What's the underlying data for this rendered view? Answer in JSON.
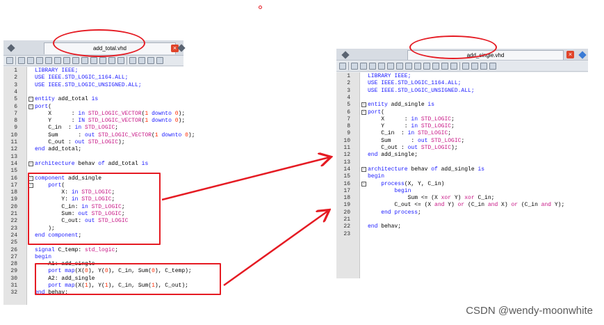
{
  "left_pane": {
    "tab_title": "add_total.vhd",
    "close_symbol": "×",
    "lines": [
      {
        "n": "1",
        "fold": "",
        "segs": [
          {
            "t": "LIBRARY IEEE;",
            "c": "kw"
          }
        ]
      },
      {
        "n": "2",
        "fold": "",
        "segs": [
          {
            "t": "USE IEEE.STD_LOGIC_1164.ALL;",
            "c": "kw"
          }
        ]
      },
      {
        "n": "3",
        "fold": "",
        "segs": [
          {
            "t": "USE IEEE.STD_LOGIC_UNSIGNED.ALL;",
            "c": "kw"
          }
        ]
      },
      {
        "n": "4",
        "fold": "",
        "segs": []
      },
      {
        "n": "5",
        "fold": "-",
        "segs": [
          {
            "t": "entity",
            "c": "kw"
          },
          {
            "t": " add_total ",
            "c": ""
          },
          {
            "t": "is",
            "c": "kw"
          }
        ]
      },
      {
        "n": "6",
        "fold": "-",
        "segs": [
          {
            "t": "port",
            "c": "kw"
          },
          {
            "t": "(",
            "c": ""
          }
        ]
      },
      {
        "n": "7",
        "fold": "",
        "segs": [
          {
            "t": "    X      : ",
            "c": ""
          },
          {
            "t": "in",
            "c": "kw"
          },
          {
            "t": " ",
            "c": ""
          },
          {
            "t": "STD_LOGIC_VECTOR",
            "c": "ty"
          },
          {
            "t": "(",
            "c": ""
          },
          {
            "t": "1",
            "c": "nm"
          },
          {
            "t": " ",
            "c": ""
          },
          {
            "t": "downto",
            "c": "kw"
          },
          {
            "t": " ",
            "c": ""
          },
          {
            "t": "0",
            "c": "nm"
          },
          {
            "t": ");",
            "c": ""
          }
        ]
      },
      {
        "n": "8",
        "fold": "",
        "segs": [
          {
            "t": "    Y      : ",
            "c": ""
          },
          {
            "t": "IN",
            "c": "kw"
          },
          {
            "t": " ",
            "c": ""
          },
          {
            "t": "STD_LOGIC_VECTOR",
            "c": "ty"
          },
          {
            "t": "(",
            "c": ""
          },
          {
            "t": "1",
            "c": "nm"
          },
          {
            "t": " ",
            "c": ""
          },
          {
            "t": "downto",
            "c": "kw"
          },
          {
            "t": " ",
            "c": ""
          },
          {
            "t": "0",
            "c": "nm"
          },
          {
            "t": ");",
            "c": ""
          }
        ]
      },
      {
        "n": "9",
        "fold": "",
        "segs": [
          {
            "t": "    C_in  : ",
            "c": ""
          },
          {
            "t": "in",
            "c": "kw"
          },
          {
            "t": " ",
            "c": ""
          },
          {
            "t": "STD_LOGIC",
            "c": "ty"
          },
          {
            "t": ";",
            "c": ""
          }
        ]
      },
      {
        "n": "10",
        "fold": "",
        "segs": [
          {
            "t": "    Sum      : ",
            "c": ""
          },
          {
            "t": "out",
            "c": "kw"
          },
          {
            "t": " ",
            "c": ""
          },
          {
            "t": "STD_LOGIC_VECTOR",
            "c": "ty"
          },
          {
            "t": "(",
            "c": ""
          },
          {
            "t": "1",
            "c": "nm"
          },
          {
            "t": " ",
            "c": ""
          },
          {
            "t": "downto",
            "c": "kw"
          },
          {
            "t": " ",
            "c": ""
          },
          {
            "t": "0",
            "c": "nm"
          },
          {
            "t": ");",
            "c": ""
          }
        ]
      },
      {
        "n": "11",
        "fold": "",
        "segs": [
          {
            "t": "    C_out : ",
            "c": ""
          },
          {
            "t": "out",
            "c": "kw"
          },
          {
            "t": " ",
            "c": ""
          },
          {
            "t": "STD_LOGIC",
            "c": "ty"
          },
          {
            "t": ");",
            "c": ""
          }
        ]
      },
      {
        "n": "12",
        "fold": "",
        "segs": [
          {
            "t": "end",
            "c": "kw"
          },
          {
            "t": " add_total;",
            "c": ""
          }
        ]
      },
      {
        "n": "13",
        "fold": "",
        "segs": []
      },
      {
        "n": "14",
        "fold": "-",
        "segs": [
          {
            "t": "architecture",
            "c": "kw"
          },
          {
            "t": " behav ",
            "c": ""
          },
          {
            "t": "of",
            "c": "kw"
          },
          {
            "t": " add_total ",
            "c": ""
          },
          {
            "t": "is",
            "c": "kw"
          }
        ]
      },
      {
        "n": "15",
        "fold": "",
        "segs": []
      },
      {
        "n": "16",
        "fold": "-",
        "segs": [
          {
            "t": "component",
            "c": "kw"
          },
          {
            "t": " add_single",
            "c": ""
          }
        ]
      },
      {
        "n": "17",
        "fold": "-",
        "segs": [
          {
            "t": "    ",
            "c": ""
          },
          {
            "t": "port",
            "c": "kw"
          },
          {
            "t": "(",
            "c": ""
          }
        ]
      },
      {
        "n": "18",
        "fold": "",
        "segs": [
          {
            "t": "        X: ",
            "c": ""
          },
          {
            "t": "in",
            "c": "kw"
          },
          {
            "t": " ",
            "c": ""
          },
          {
            "t": "STD_LOGIC",
            "c": "ty"
          },
          {
            "t": ";",
            "c": ""
          }
        ]
      },
      {
        "n": "19",
        "fold": "",
        "segs": [
          {
            "t": "        Y: ",
            "c": ""
          },
          {
            "t": "in",
            "c": "kw"
          },
          {
            "t": " ",
            "c": ""
          },
          {
            "t": "STD_LOGIC",
            "c": "ty"
          },
          {
            "t": ";",
            "c": ""
          }
        ]
      },
      {
        "n": "20",
        "fold": "",
        "segs": [
          {
            "t": "        C_in: ",
            "c": ""
          },
          {
            "t": "in",
            "c": "kw"
          },
          {
            "t": " ",
            "c": ""
          },
          {
            "t": "STD_LOGIC",
            "c": "ty"
          },
          {
            "t": ";",
            "c": ""
          }
        ]
      },
      {
        "n": "21",
        "fold": "",
        "segs": [
          {
            "t": "        Sum: ",
            "c": ""
          },
          {
            "t": "out",
            "c": "kw"
          },
          {
            "t": " ",
            "c": ""
          },
          {
            "t": "STD_LOGIC",
            "c": "ty"
          },
          {
            "t": ";",
            "c": ""
          }
        ]
      },
      {
        "n": "22",
        "fold": "",
        "segs": [
          {
            "t": "        C_out: ",
            "c": ""
          },
          {
            "t": "out",
            "c": "kw"
          },
          {
            "t": " ",
            "c": ""
          },
          {
            "t": "STD_LOGIC",
            "c": "ty"
          }
        ]
      },
      {
        "n": "23",
        "fold": "",
        "segs": [
          {
            "t": "    );",
            "c": ""
          }
        ]
      },
      {
        "n": "24",
        "fold": "",
        "segs": [
          {
            "t": "end",
            "c": "kw"
          },
          {
            "t": " ",
            "c": ""
          },
          {
            "t": "component",
            "c": "kw"
          },
          {
            "t": ";",
            "c": ""
          }
        ]
      },
      {
        "n": "25",
        "fold": "",
        "segs": []
      },
      {
        "n": "26",
        "fold": "",
        "segs": [
          {
            "t": "signal",
            "c": "kw"
          },
          {
            "t": " C_temp: ",
            "c": ""
          },
          {
            "t": "std_logic",
            "c": "ty"
          },
          {
            "t": ";",
            "c": ""
          }
        ]
      },
      {
        "n": "27",
        "fold": "",
        "segs": [
          {
            "t": "begin",
            "c": "kw"
          }
        ]
      },
      {
        "n": "28",
        "fold": "",
        "segs": [
          {
            "t": "    A1: add_single",
            "c": ""
          }
        ]
      },
      {
        "n": "29",
        "fold": "",
        "segs": [
          {
            "t": "    ",
            "c": ""
          },
          {
            "t": "port",
            "c": "kw"
          },
          {
            "t": " ",
            "c": ""
          },
          {
            "t": "map",
            "c": "kw"
          },
          {
            "t": "(X(",
            "c": ""
          },
          {
            "t": "0",
            "c": "nm"
          },
          {
            "t": "), Y(",
            "c": ""
          },
          {
            "t": "0",
            "c": "nm"
          },
          {
            "t": "), C_in, Sum(",
            "c": ""
          },
          {
            "t": "0",
            "c": "nm"
          },
          {
            "t": "), C_temp);",
            "c": ""
          }
        ]
      },
      {
        "n": "30",
        "fold": "",
        "segs": [
          {
            "t": "    A2: add_single",
            "c": ""
          }
        ]
      },
      {
        "n": "31",
        "fold": "",
        "segs": [
          {
            "t": "    ",
            "c": ""
          },
          {
            "t": "port",
            "c": "kw"
          },
          {
            "t": " ",
            "c": ""
          },
          {
            "t": "map",
            "c": "kw"
          },
          {
            "t": "(X(",
            "c": ""
          },
          {
            "t": "1",
            "c": "nm"
          },
          {
            "t": "), Y(",
            "c": ""
          },
          {
            "t": "1",
            "c": "nm"
          },
          {
            "t": "), C_in, Sum(",
            "c": ""
          },
          {
            "t": "1",
            "c": "nm"
          },
          {
            "t": "), C_out);",
            "c": ""
          }
        ]
      },
      {
        "n": "32",
        "fold": "",
        "segs": [
          {
            "t": "end",
            "c": "kw"
          },
          {
            "t": " behav;",
            "c": ""
          }
        ]
      }
    ]
  },
  "right_pane": {
    "tab_title": "add_single.vhd",
    "close_symbol": "×",
    "lines": [
      {
        "n": "1",
        "fold": "",
        "segs": [
          {
            "t": "LIBRARY IEEE;",
            "c": "kw"
          }
        ]
      },
      {
        "n": "2",
        "fold": "",
        "segs": [
          {
            "t": "USE IEEE.STD_LOGIC_1164.ALL;",
            "c": "kw"
          }
        ]
      },
      {
        "n": "3",
        "fold": "",
        "segs": [
          {
            "t": "USE IEEE.STD_LOGIC_UNSIGNED.ALL;",
            "c": "kw"
          }
        ]
      },
      {
        "n": "4",
        "fold": "",
        "segs": []
      },
      {
        "n": "5",
        "fold": "-",
        "segs": [
          {
            "t": "entity",
            "c": "kw"
          },
          {
            "t": " add_single ",
            "c": ""
          },
          {
            "t": "is",
            "c": "kw"
          }
        ]
      },
      {
        "n": "6",
        "fold": "-",
        "segs": [
          {
            "t": "port",
            "c": "kw"
          },
          {
            "t": "(",
            "c": ""
          }
        ]
      },
      {
        "n": "7",
        "fold": "",
        "segs": [
          {
            "t": "    X      : ",
            "c": ""
          },
          {
            "t": "in",
            "c": "kw"
          },
          {
            "t": " ",
            "c": ""
          },
          {
            "t": "STD_LOGIC",
            "c": "ty"
          },
          {
            "t": ";",
            "c": ""
          }
        ]
      },
      {
        "n": "8",
        "fold": "",
        "segs": [
          {
            "t": "    Y      : ",
            "c": ""
          },
          {
            "t": "in",
            "c": "kw"
          },
          {
            "t": " ",
            "c": ""
          },
          {
            "t": "STD_LOGIC",
            "c": "ty"
          },
          {
            "t": ";",
            "c": ""
          }
        ]
      },
      {
        "n": "9",
        "fold": "",
        "segs": [
          {
            "t": "    C_in  : ",
            "c": ""
          },
          {
            "t": "in",
            "c": "kw"
          },
          {
            "t": " ",
            "c": ""
          },
          {
            "t": "STD_LOGIC",
            "c": "ty"
          },
          {
            "t": ";",
            "c": ""
          }
        ]
      },
      {
        "n": "10",
        "fold": "",
        "segs": [
          {
            "t": "    Sum      : ",
            "c": ""
          },
          {
            "t": "out",
            "c": "kw"
          },
          {
            "t": " ",
            "c": ""
          },
          {
            "t": "STD_LOGIC",
            "c": "ty"
          },
          {
            "t": ";",
            "c": ""
          }
        ]
      },
      {
        "n": "11",
        "fold": "",
        "segs": [
          {
            "t": "    C_out : ",
            "c": ""
          },
          {
            "t": "out",
            "c": "kw"
          },
          {
            "t": " ",
            "c": ""
          },
          {
            "t": "STD_LOGIC",
            "c": "ty"
          },
          {
            "t": ");",
            "c": ""
          }
        ]
      },
      {
        "n": "12",
        "fold": "",
        "segs": [
          {
            "t": "end",
            "c": "kw"
          },
          {
            "t": " add_single;",
            "c": ""
          }
        ]
      },
      {
        "n": "13",
        "fold": "",
        "segs": []
      },
      {
        "n": "14",
        "fold": "-",
        "segs": [
          {
            "t": "architecture",
            "c": "kw"
          },
          {
            "t": " behav ",
            "c": ""
          },
          {
            "t": "of",
            "c": "kw"
          },
          {
            "t": " add_single ",
            "c": ""
          },
          {
            "t": "is",
            "c": "kw"
          }
        ]
      },
      {
        "n": "15",
        "fold": "",
        "segs": [
          {
            "t": "begin",
            "c": "kw"
          }
        ]
      },
      {
        "n": "16",
        "fold": "-",
        "segs": [
          {
            "t": "    ",
            "c": ""
          },
          {
            "t": "process",
            "c": "kw"
          },
          {
            "t": "(X, Y, C_in)",
            "c": ""
          }
        ]
      },
      {
        "n": "17",
        "fold": "",
        "segs": [
          {
            "t": "        ",
            "c": ""
          },
          {
            "t": "begin",
            "c": "kw"
          }
        ]
      },
      {
        "n": "18",
        "fold": "",
        "segs": [
          {
            "t": "            Sum <= (X ",
            "c": ""
          },
          {
            "t": "xor",
            "c": "ty"
          },
          {
            "t": " Y) ",
            "c": ""
          },
          {
            "t": "xor",
            "c": "ty"
          },
          {
            "t": " C_in;",
            "c": ""
          }
        ]
      },
      {
        "n": "19",
        "fold": "",
        "segs": [
          {
            "t": "        C_out <= (X ",
            "c": ""
          },
          {
            "t": "and",
            "c": "ty"
          },
          {
            "t": " Y) ",
            "c": ""
          },
          {
            "t": "or",
            "c": "ty"
          },
          {
            "t": " (C_in ",
            "c": ""
          },
          {
            "t": "and",
            "c": "ty"
          },
          {
            "t": " X) ",
            "c": ""
          },
          {
            "t": "or",
            "c": "ty"
          },
          {
            "t": " (C_in ",
            "c": ""
          },
          {
            "t": "and",
            "c": "ty"
          },
          {
            "t": " Y);",
            "c": ""
          }
        ]
      },
      {
        "n": "20",
        "fold": "",
        "segs": [
          {
            "t": "    ",
            "c": ""
          },
          {
            "t": "end",
            "c": "kw"
          },
          {
            "t": " ",
            "c": ""
          },
          {
            "t": "process",
            "c": "kw"
          },
          {
            "t": ";",
            "c": ""
          }
        ]
      },
      {
        "n": "21",
        "fold": "",
        "segs": []
      },
      {
        "n": "22",
        "fold": "",
        "segs": [
          {
            "t": "end",
            "c": "kw"
          },
          {
            "t": " behav;",
            "c": ""
          }
        ]
      },
      {
        "n": "23",
        "fold": "",
        "segs": []
      }
    ]
  },
  "watermark": "CSDN @wendy-moonwhite",
  "colors": {
    "annotation_red": "#e51b23",
    "keyword": "#1a1aff",
    "type": "#c71585",
    "number": "#ff2a00"
  }
}
